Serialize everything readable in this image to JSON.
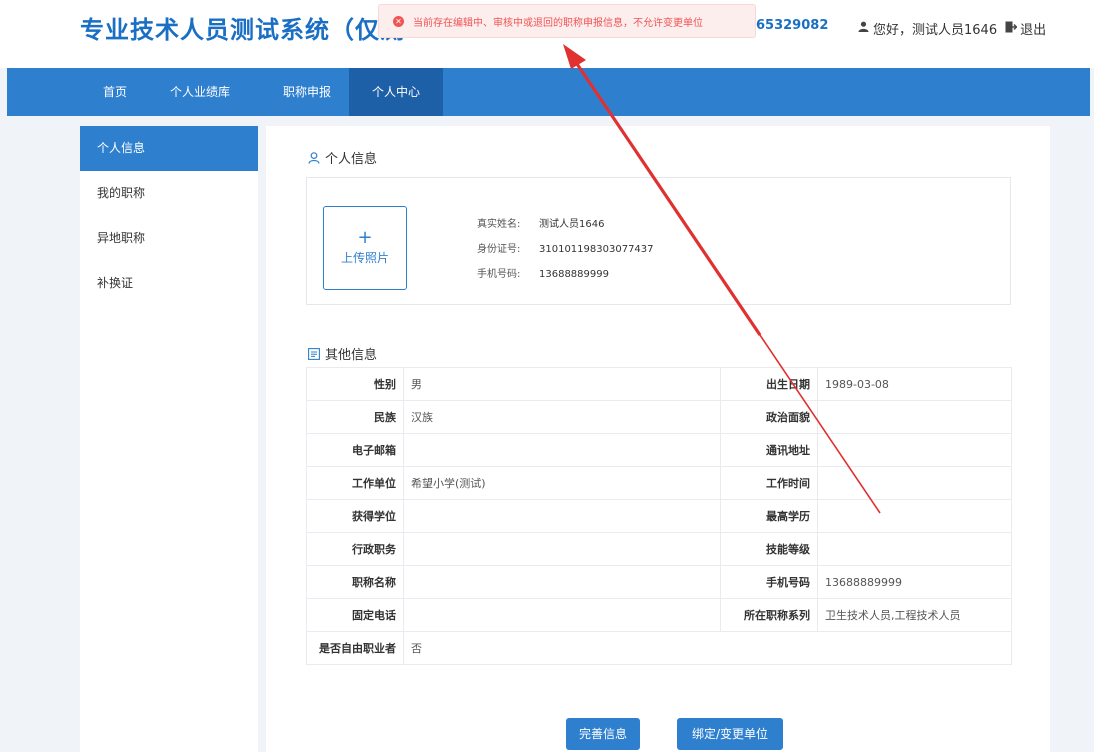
{
  "header": {
    "title": "专业技术人员测试系统（仅测",
    "phone_tail": "65329082",
    "greeting": "您好，测试人员1646",
    "logout": "退出",
    "user_icon": "user-icon",
    "logout_icon": "logout-icon"
  },
  "toast": {
    "message": "当前存在编辑中、审核中或退回的职称申报信息，不允许变更单位",
    "icon": "error-circle-icon",
    "color": "#f05454"
  },
  "nav": {
    "items": [
      "首页",
      "个人业绩库",
      "职称申报",
      "个人中心"
    ],
    "active": "个人中心"
  },
  "sidebar": {
    "items": [
      "个人信息",
      "我的职称",
      "异地职称",
      "补换证"
    ],
    "active": "个人信息"
  },
  "personal": {
    "section_title": "个人信息",
    "upload_plus": "+",
    "upload_label": "上传照片",
    "name_label": "真实姓名:",
    "name": "测试人员1646",
    "id_label": "身份证号:",
    "id": "310101198303077437",
    "mobile_label": "手机号码:",
    "mobile": "13688889999"
  },
  "other": {
    "section_title": "其他信息",
    "rows": [
      {
        "l1": "性别",
        "v1": "男",
        "l2": "出生日期",
        "v2": "1989-03-08"
      },
      {
        "l1": "民族",
        "v1": "汉族",
        "l2": "政治面貌",
        "v2": ""
      },
      {
        "l1": "电子邮箱",
        "v1": "",
        "l2": "通讯地址",
        "v2": ""
      },
      {
        "l1": "工作单位",
        "v1": "希望小学(测试)",
        "l2": "工作时间",
        "v2": ""
      },
      {
        "l1": "获得学位",
        "v1": "",
        "l2": "最高学历",
        "v2": ""
      },
      {
        "l1": "行政职务",
        "v1": "",
        "l2": "技能等级",
        "v2": ""
      },
      {
        "l1": "职称名称",
        "v1": "",
        "l2": "手机号码",
        "v2": "13688889999"
      },
      {
        "l1": "固定电话",
        "v1": "",
        "l2": "所在职称系列",
        "v2": "卫生技术人员,工程技术人员"
      }
    ],
    "last_row": {
      "l1": "是否自由职业者",
      "v1": "否"
    }
  },
  "buttons": {
    "complete": "完善信息",
    "bind": "绑定/变更单位"
  },
  "colors": {
    "primary": "#2f7fcf",
    "nav_active": "#1e60a8",
    "title": "#1a6fc4",
    "annotation_arrow": "#e03030"
  }
}
